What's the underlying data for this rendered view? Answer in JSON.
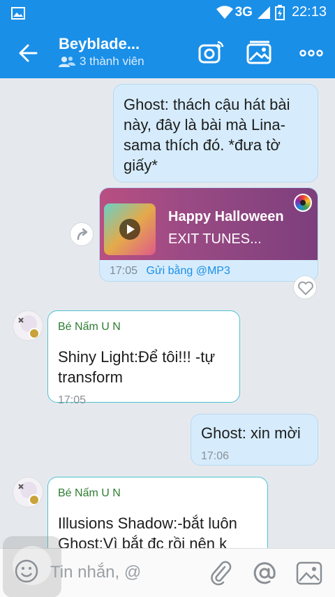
{
  "statusbar": {
    "network": "3G",
    "time": "22:13"
  },
  "header": {
    "title": "Beyblade...",
    "members": "3 thành viên"
  },
  "messages": {
    "m1": {
      "text": "Ghost: thách cậu hát bài này, đây là bài mà Lina-sama thích đó. *đưa tờ giấy*"
    },
    "music": {
      "title": "Happy Halloween",
      "artist": "EXIT TUNES...",
      "time": "17:05",
      "source": "Gửi bằng @MP3"
    },
    "m2": {
      "sender": "Bé Nấm U N",
      "text": "Shiny Light:Để tôi!!! -tự transform",
      "time": "17:05"
    },
    "m3": {
      "text": "Ghost: xin mời",
      "time": "17:06"
    },
    "m4": {
      "sender": "Bé Nấm U N",
      "text": "Illusions Shadow:-bắt luôn Ghost:Vì bắt đc rồi nên k"
    }
  },
  "input": {
    "placeholder": "Tin nhắn, @"
  },
  "colors": {
    "primary": "#1a8fe8",
    "bubble_me": "#d6ecfc",
    "bubble_other_border": "#4fc3d0",
    "sender": "#2e7d32"
  }
}
